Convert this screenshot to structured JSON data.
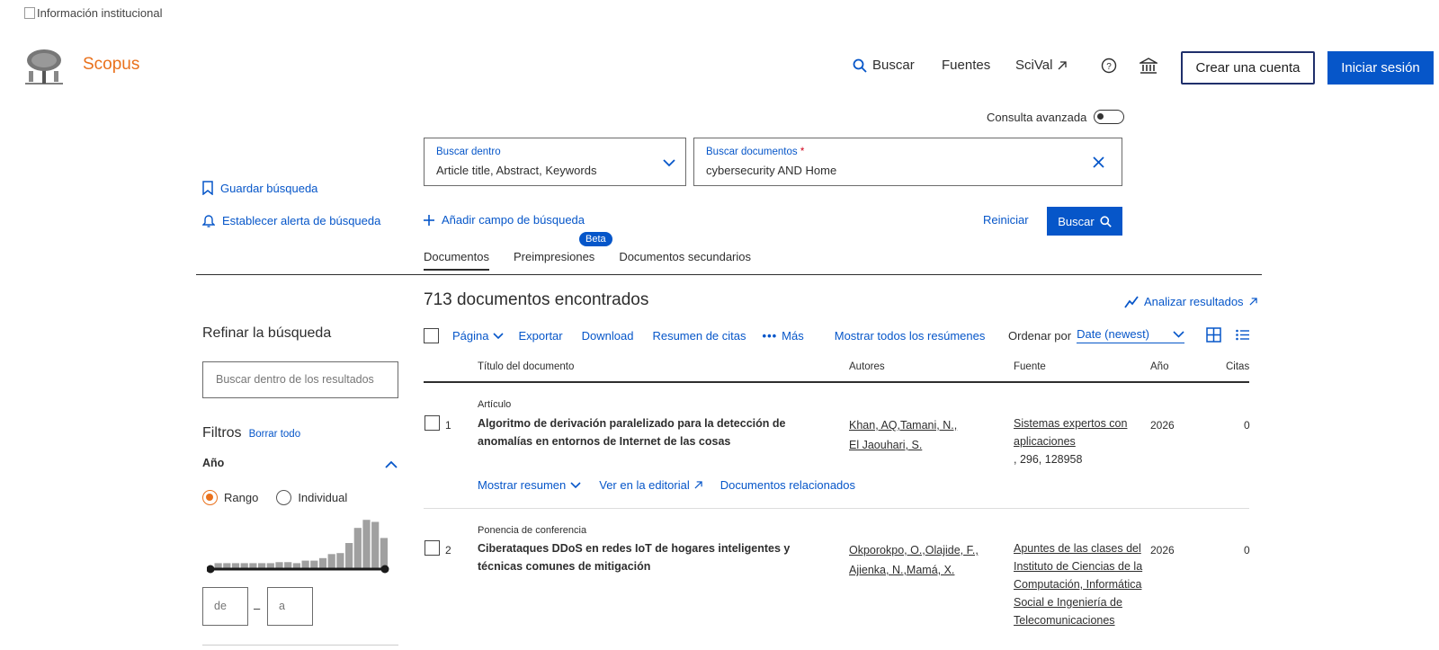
{
  "header": {
    "institution_alt": "Información institucional",
    "brand": "Scopus",
    "nav": {
      "search": "Buscar",
      "sources": "Fuentes",
      "scival": "SciVal",
      "create_account": "Crear una cuenta",
      "sign_in": "Iniciar sesión"
    }
  },
  "search": {
    "advanced_label": "Consulta avanzada",
    "within_label": "Buscar dentro",
    "within_value": "Article title, Abstract, Keywords",
    "docs_label": "Buscar documentos",
    "required_mark": "*",
    "docs_value": "cybersecurity AND Home",
    "add_field": "Añadir campo de búsqueda",
    "reset": "Reiniciar",
    "search_button": "Buscar",
    "save_search": "Guardar búsqueda",
    "set_alert": "Establecer alerta de búsqueda"
  },
  "tabs": [
    {
      "label": "Documentos",
      "active": true
    },
    {
      "label": "Preimpresiones",
      "badge": "Beta"
    },
    {
      "label": "Documentos secundarios"
    }
  ],
  "results": {
    "count_text": "713 documentos encontrados",
    "analyze": "Analizar resultados",
    "toolbar": {
      "page": "Página",
      "export": "Exportar",
      "download": "Download",
      "citations": "Resumen de citas",
      "more": "Más",
      "show_abstracts": "Mostrar todos los resúmenes",
      "sort_label": "Ordenar por",
      "sort_value": "Date (newest)"
    },
    "columns": {
      "title": "Título del documento",
      "authors": "Autores",
      "source": "Fuente",
      "year": "Año",
      "citations": "Citas"
    },
    "rows": [
      {
        "index": "1",
        "type": "Artículo",
        "title": "Algoritmo de derivación paralelizado para la detección de anomalías en entornos de Internet de las cosas",
        "authors": [
          "Khan, AQ,",
          "Tamani, N.,",
          "El Jaouhari, S."
        ],
        "source": "Sistemas expertos con aplicaciones",
        "source_detail": ", 296, 128958",
        "year": "2026",
        "citations": "0",
        "links": {
          "abstract": "Mostrar resumen",
          "publisher": "Ver en la editorial",
          "related": "Documentos relacionados"
        }
      },
      {
        "index": "2",
        "type": "Ponencia de conferencia",
        "title": "Ciberataques DDoS en redes IoT de hogares inteligentes y técnicas comunes de mitigación",
        "authors": [
          "Okporokpo, O.,",
          "Olajide, F.,",
          "Ajienka, N.,",
          "Mamá, X."
        ],
        "source": "Apuntes de las clases del Instituto de Ciencias de la Computación, Informática Social e Ingeniería de Telecomunicaciones",
        "year": "2026",
        "citations": "0"
      }
    ]
  },
  "filters": {
    "refine_title": "Refinar la búsqueda",
    "refine_placeholder": "Buscar dentro de los resultados",
    "filters_title": "Filtros",
    "clear_all": "Borrar todo",
    "year_title": "Año",
    "range_label": "Rango",
    "single_label": "Individual",
    "range_selected": "Rango",
    "from_placeholder": "de",
    "to_placeholder": "a",
    "separator": "–",
    "histogram_relative_heights": [
      0.1,
      0.1,
      0.1,
      0.1,
      0.1,
      0.1,
      0.1,
      0.12,
      0.12,
      0.1,
      0.15,
      0.15,
      0.2,
      0.28,
      0.3,
      0.5,
      0.8,
      0.96,
      0.92,
      0.6
    ]
  },
  "colors": {
    "brand_orange": "#e9711c",
    "primary_blue": "#0656c9",
    "text": "#2e2e2e"
  }
}
